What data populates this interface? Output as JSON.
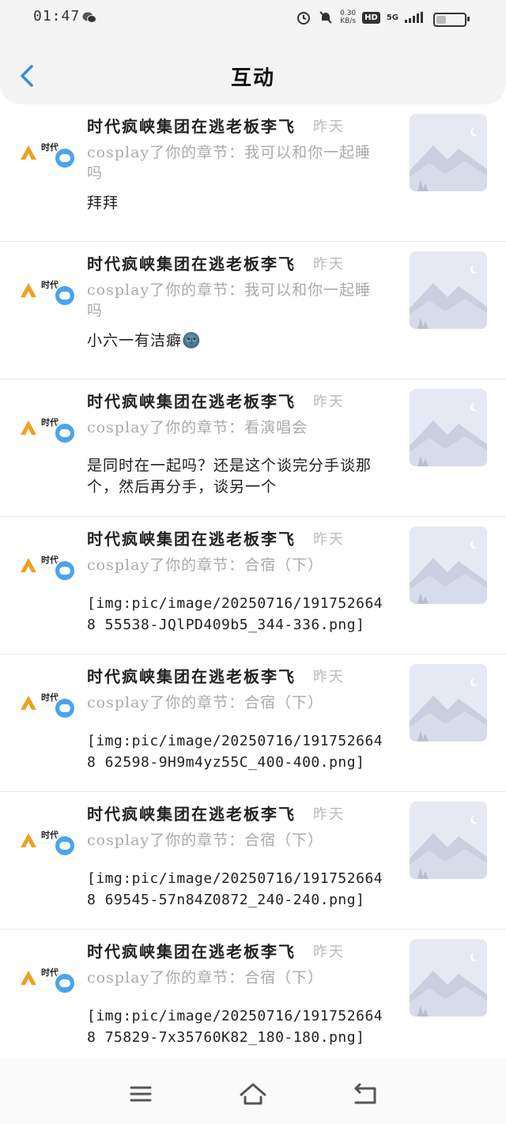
{
  "status": {
    "time": "01:47",
    "speed": "0.30",
    "speed_unit": "KB/s",
    "hd": "HD",
    "network": "5G"
  },
  "header": {
    "title": "互动"
  },
  "items": [
    {
      "author": "时代疯峡集团在逃老板李飞",
      "time": "昨天",
      "desc": "cosplay了你的章节：我可以和你一起睡吗",
      "content": "拜拜"
    },
    {
      "author": "时代疯峡集团在逃老板李飞",
      "time": "昨天",
      "desc": "cosplay了你的章节：我可以和你一起睡吗",
      "content": "小六一有洁癖🌚"
    },
    {
      "author": "时代疯峡集团在逃老板李飞",
      "time": "昨天",
      "desc": "cosplay了你的章节：看演唱会",
      "content": "是同时在一起吗？还是这个谈完分手谈那个，然后再分手，谈另一个"
    },
    {
      "author": "时代疯峡集团在逃老板李飞",
      "time": "昨天",
      "desc": "cosplay了你的章节：合宿（下）",
      "content": "[img:pic/image/20250716/1917526648 55538-JQlPD409b5_344-336.png]"
    },
    {
      "author": "时代疯峡集团在逃老板李飞",
      "time": "昨天",
      "desc": "cosplay了你的章节：合宿（下）",
      "content": "[img:pic/image/20250716/1917526648 62598-9H9m4yz55C_400-400.png]"
    },
    {
      "author": "时代疯峡集团在逃老板李飞",
      "time": "昨天",
      "desc": "cosplay了你的章节：合宿（下）",
      "content": "[img:pic/image/20250716/1917526648 69545-57n84Z0872_240-240.png]"
    },
    {
      "author": "时代疯峡集团在逃老板李飞",
      "time": "昨天",
      "desc": "cosplay了你的章节：合宿（下）",
      "content": "[img:pic/image/20250716/1917526648 75829-7x35760K82_180-180.png]"
    }
  ],
  "colors": {
    "accent": "#2b8ff0",
    "badge": "#4aa3f0",
    "muted_text": "#aaaaaa"
  },
  "icons": {
    "back": "back-arrow-icon",
    "badge": "comment-bubble-icon",
    "thumb": "image-placeholder-icon",
    "nav": [
      "menu-icon",
      "home-icon",
      "return-icon"
    ]
  }
}
